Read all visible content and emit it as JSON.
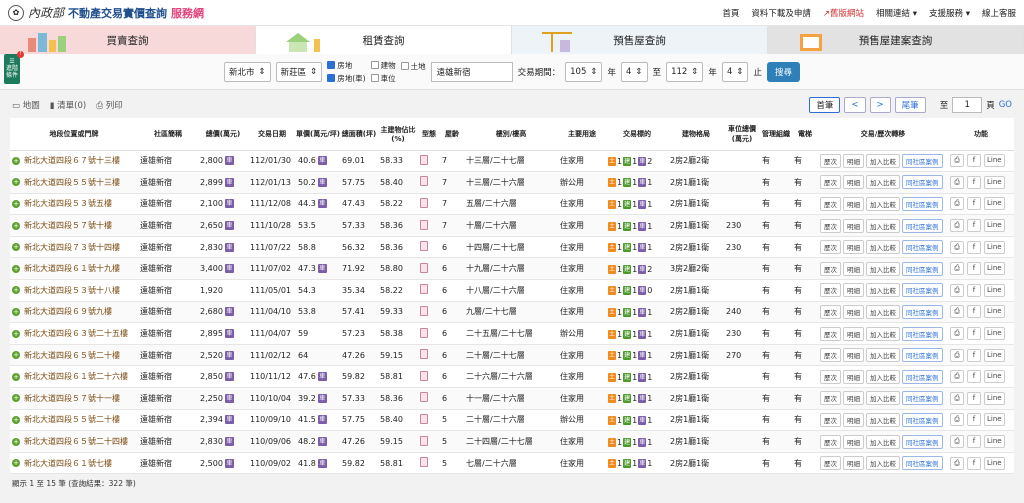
{
  "header": {
    "logo_mark": "內政部",
    "title": "不動產交易實價查詢",
    "title_suffix": "服務網",
    "nav": [
      "首頁",
      "資料下載及申請",
      "舊版網站",
      "相關連結",
      "支援服務",
      "線上客服"
    ]
  },
  "tabs": [
    "買賣查詢",
    "租賃查詢",
    "預售屋查詢",
    "預售屋建案查詢"
  ],
  "side_badge": {
    "label": "進階條件",
    "count": "!"
  },
  "filter": {
    "city": "新北市",
    "district": "新莊區",
    "types": [
      {
        "label": "房地",
        "checked": true
      },
      {
        "label": "建物",
        "checked": false
      },
      {
        "label": "土地",
        "checked": false
      },
      {
        "label": "房地(車)",
        "checked": true
      },
      {
        "label": "車位",
        "checked": false
      }
    ],
    "keyword": "遠雄新宿",
    "period_label": "交易期間：",
    "from_year": "105",
    "from_month": "4",
    "to_year": "112",
    "to_month": "4",
    "year_unit": "年",
    "to_label": "至",
    "end_label": "止",
    "search_btn": "搜尋"
  },
  "toolbar": {
    "map": "地圖",
    "list": "清單(0)",
    "print": "列印"
  },
  "pager": {
    "first": "首筆",
    "prev": "<",
    "next": ">",
    "last": "尾筆",
    "to": "至",
    "page": "1",
    "page_unit": "頁",
    "go": "GO"
  },
  "columns": [
    "地段位置或門牌",
    "社區簡稱",
    "總價(萬元)",
    "交易日期",
    "單價(萬元/坪)",
    "總面積(坪)",
    "主建物佔比(%)",
    "型態",
    "屋齡",
    "樓別/樓高",
    "主要用途",
    "交易標的",
    "建物格局",
    "車位總價(萬元)",
    "管理組織",
    "電梯",
    "交易/歷次轉移",
    "功能"
  ],
  "action_labels": {
    "history": "歷次",
    "detail": "明細",
    "compare": "加入比較",
    "community": "同社區案例",
    "share_fb": "f",
    "share_line": "Line"
  },
  "rows": [
    {
      "addr": "新北大道四段６７號十三樓",
      "comm": "遠雄新宿",
      "total": "2,800",
      "pk": true,
      "date": "112/01/30",
      "unit": "40.6",
      "upk": true,
      "area": "69.01",
      "ratio": "58.33",
      "age": "7",
      "floor": "十三層/二十七層",
      "use": "住家用",
      "bt": [
        "1",
        "1",
        "2"
      ],
      "layout": "2房2廳2衛",
      "park": "",
      "mgmt": "有",
      "elev": "有"
    },
    {
      "addr": "新北大道四段５５號十三樓",
      "comm": "遠雄新宿",
      "total": "2,899",
      "pk": true,
      "date": "112/01/13",
      "unit": "50.2",
      "upk": true,
      "area": "57.75",
      "ratio": "58.40",
      "age": "7",
      "floor": "十三層/二十六層",
      "use": "辦公用",
      "bt": [
        "1",
        "1",
        "1"
      ],
      "layout": "2房1廳1衛",
      "park": "",
      "mgmt": "有",
      "elev": "有"
    },
    {
      "addr": "新北大道四段５３號五樓",
      "comm": "遠雄新宿",
      "total": "2,100",
      "pk": true,
      "date": "111/12/08",
      "unit": "44.3",
      "upk": true,
      "area": "47.43",
      "ratio": "58.22",
      "age": "7",
      "floor": "五層/二十六層",
      "use": "住家用",
      "bt": [
        "1",
        "1",
        "1"
      ],
      "layout": "2房1廳1衛",
      "park": "",
      "mgmt": "有",
      "elev": "有"
    },
    {
      "addr": "新北大道四段５７號十樓",
      "comm": "遠雄新宿",
      "total": "2,650",
      "pk": true,
      "date": "111/10/28",
      "unit": "53.5",
      "upk": false,
      "area": "57.33",
      "ratio": "58.36",
      "age": "7",
      "floor": "十層/二十六層",
      "use": "住家用",
      "bt": [
        "1",
        "1",
        "1"
      ],
      "layout": "2房1廳1衛",
      "park": "230",
      "mgmt": "有",
      "elev": "有"
    },
    {
      "addr": "新北大道四段７３號十四樓",
      "comm": "遠雄新宿",
      "total": "2,830",
      "pk": true,
      "date": "111/07/22",
      "unit": "58.8",
      "upk": false,
      "area": "56.32",
      "ratio": "58.36",
      "age": "6",
      "floor": "十四層/二十七層",
      "use": "住家用",
      "bt": [
        "1",
        "1",
        "1"
      ],
      "layout": "2房2廳1衛",
      "park": "230",
      "mgmt": "有",
      "elev": "有"
    },
    {
      "addr": "新北大道四段６１號十九樓",
      "comm": "遠雄新宿",
      "total": "3,400",
      "pk": true,
      "date": "111/07/02",
      "unit": "47.3",
      "upk": true,
      "area": "71.92",
      "ratio": "58.80",
      "age": "6",
      "floor": "十九層/二十六層",
      "use": "住家用",
      "bt": [
        "1",
        "1",
        "2"
      ],
      "layout": "3房2廳2衛",
      "park": "",
      "mgmt": "有",
      "elev": "有"
    },
    {
      "addr": "新北大道四段５３號十八樓",
      "comm": "遠雄新宿",
      "total": "1,920",
      "pk": false,
      "date": "111/05/01",
      "unit": "54.3",
      "upk": false,
      "area": "35.34",
      "ratio": "58.22",
      "age": "6",
      "floor": "十八層/二十六層",
      "use": "住家用",
      "bt": [
        "1",
        "1",
        "0"
      ],
      "layout": "2房1廳1衛",
      "park": "",
      "mgmt": "有",
      "elev": "有"
    },
    {
      "addr": "新北大道四段６９號九樓",
      "comm": "遠雄新宿",
      "total": "2,680",
      "pk": true,
      "date": "111/04/10",
      "unit": "53.8",
      "upk": false,
      "area": "57.41",
      "ratio": "59.33",
      "age": "6",
      "floor": "九層/二十七層",
      "use": "住家用",
      "bt": [
        "1",
        "1",
        "1"
      ],
      "layout": "2房2廳1衛",
      "park": "240",
      "mgmt": "有",
      "elev": "有"
    },
    {
      "addr": "新北大道四段６３號二十五樓",
      "comm": "遠雄新宿",
      "total": "2,895",
      "pk": true,
      "date": "111/04/07",
      "unit": "59",
      "upk": false,
      "area": "57.23",
      "ratio": "58.38",
      "age": "6",
      "floor": "二十五層/二十七層",
      "use": "辦公用",
      "bt": [
        "1",
        "1",
        "1"
      ],
      "layout": "2房1廳1衛",
      "park": "230",
      "mgmt": "有",
      "elev": "有"
    },
    {
      "addr": "新北大道四段６５號二十樓",
      "comm": "遠雄新宿",
      "total": "2,520",
      "pk": true,
      "date": "111/02/12",
      "unit": "64",
      "upk": false,
      "area": "47.26",
      "ratio": "59.15",
      "age": "6",
      "floor": "二十層/二十七層",
      "use": "住家用",
      "bt": [
        "1",
        "1",
        "1"
      ],
      "layout": "2房1廳1衛",
      "park": "270",
      "mgmt": "有",
      "elev": "有"
    },
    {
      "addr": "新北大道四段６１號二十六樓",
      "comm": "遠雄新宿",
      "total": "2,850",
      "pk": true,
      "date": "110/11/12",
      "unit": "47.6",
      "upk": true,
      "area": "59.82",
      "ratio": "58.81",
      "age": "6",
      "floor": "二十六層/二十六層",
      "use": "住家用",
      "bt": [
        "1",
        "1",
        "1"
      ],
      "layout": "2房2廳1衛",
      "park": "",
      "mgmt": "有",
      "elev": "有"
    },
    {
      "addr": "新北大道四段５７號十一樓",
      "comm": "遠雄新宿",
      "total": "2,250",
      "pk": true,
      "date": "110/10/04",
      "unit": "39.2",
      "upk": true,
      "area": "57.33",
      "ratio": "58.36",
      "age": "6",
      "floor": "十一層/二十六層",
      "use": "住家用",
      "bt": [
        "1",
        "1",
        "1"
      ],
      "layout": "2房1廳1衛",
      "park": "",
      "mgmt": "有",
      "elev": "有"
    },
    {
      "addr": "新北大道四段５５號二十樓",
      "comm": "遠雄新宿",
      "total": "2,394",
      "pk": true,
      "date": "110/09/10",
      "unit": "41.5",
      "upk": true,
      "area": "57.75",
      "ratio": "58.40",
      "age": "5",
      "floor": "二十層/二十六層",
      "use": "辦公用",
      "bt": [
        "1",
        "1",
        "1"
      ],
      "layout": "2房1廳1衛",
      "park": "",
      "mgmt": "有",
      "elev": "有"
    },
    {
      "addr": "新北大道四段６５號二十四樓",
      "comm": "遠雄新宿",
      "total": "2,830",
      "pk": true,
      "date": "110/09/06",
      "unit": "48.2",
      "upk": true,
      "area": "47.26",
      "ratio": "59.15",
      "age": "5",
      "floor": "二十四層/二十七層",
      "use": "住家用",
      "bt": [
        "1",
        "1",
        "1"
      ],
      "layout": "2房1廳1衛",
      "park": "",
      "mgmt": "有",
      "elev": "有"
    },
    {
      "addr": "新北大道四段６１號七樓",
      "comm": "遠雄新宿",
      "total": "2,500",
      "pk": true,
      "date": "110/09/02",
      "unit": "41.8",
      "upk": true,
      "area": "59.82",
      "ratio": "58.81",
      "age": "5",
      "floor": "七層/二十六層",
      "use": "住家用",
      "bt": [
        "1",
        "1",
        "1"
      ],
      "layout": "2房2廳1衛",
      "park": "",
      "mgmt": "有",
      "elev": "有"
    }
  ],
  "footer": "顯示 1 至 15 筆 (查詢結果：322 筆)"
}
